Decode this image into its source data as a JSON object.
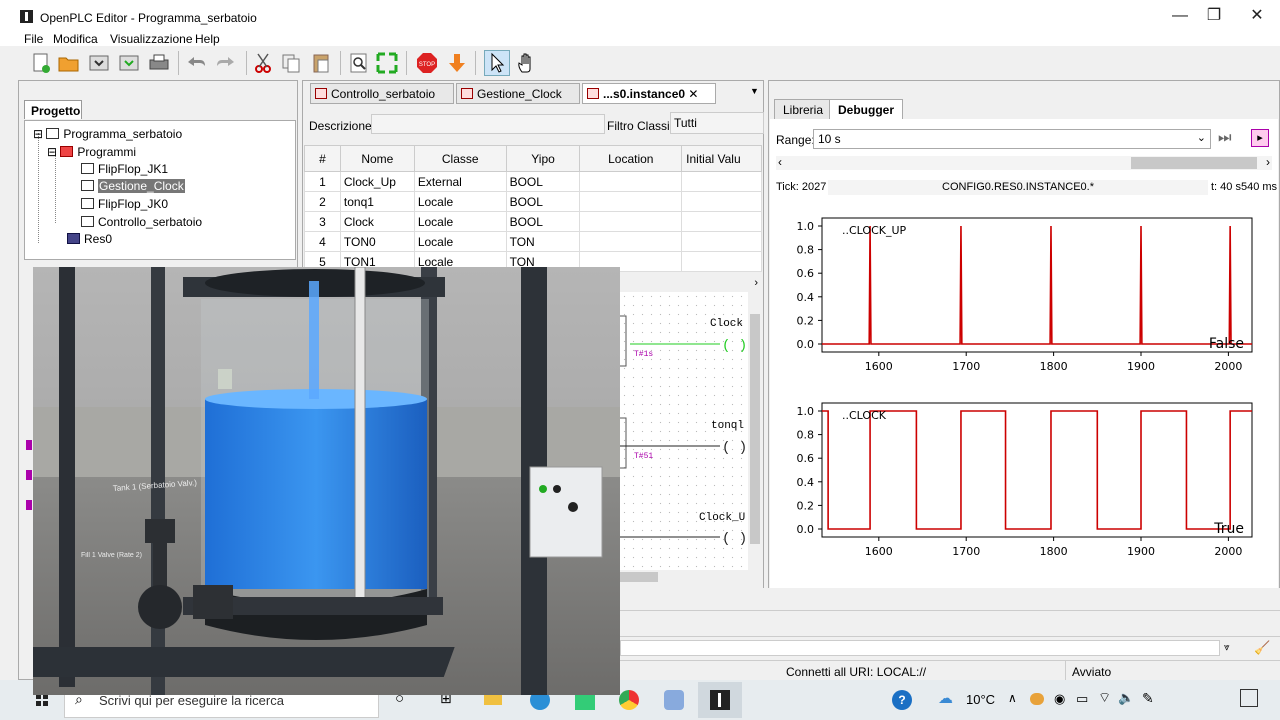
{
  "window": {
    "title": "OpenPLC Editor - Programma_serbatoio",
    "controls": {
      "minimize": "—",
      "maximize": "❐",
      "close": "✕"
    }
  },
  "menu": [
    "File",
    "Modifica",
    "Visualizzazione",
    "Help"
  ],
  "toolbar_icons": [
    "new-file-icon",
    "open-folder-icon",
    "save-icon",
    "save-as-icon",
    "print-icon",
    "undo-icon",
    "redo-icon",
    "cut-icon",
    "copy-icon",
    "paste-icon",
    "find-icon",
    "fullscreen-icon",
    "stop-icon",
    "download-icon",
    "pointer-icon",
    "hand-icon"
  ],
  "project": {
    "tab_label": "Progetto",
    "tree": {
      "root": "Programma_serbatoio",
      "programs_folder": "Programmi",
      "programs": [
        "FlipFlop_JK1",
        "Gestione_Clock",
        "FlipFlop_JK0",
        "Controllo_serbatoio"
      ],
      "selected": "Gestione_Clock",
      "resource": "Res0"
    }
  },
  "editor": {
    "tabs": [
      "Controllo_serbatoio",
      "Gestione_Clock",
      "...s0.instance0"
    ],
    "active_tab": "...s0.instance0",
    "description_label": "Descrizione:",
    "description_value": "",
    "class_filter_label": "Filtro Classi:",
    "class_filter_value": "Tutti",
    "columns": [
      "#",
      "Nome",
      "Classe",
      "Yipo",
      "Location",
      "Initial Valu"
    ],
    "rows": [
      {
        "n": "1",
        "name": "Clock_Up",
        "class": "External",
        "type": "BOOL",
        "location": "",
        "initial": ""
      },
      {
        "n": "2",
        "name": "tonq1",
        "class": "Locale",
        "type": "BOOL",
        "location": "",
        "initial": ""
      },
      {
        "n": "3",
        "name": "Clock",
        "class": "Locale",
        "type": "BOOL",
        "location": "",
        "initial": ""
      },
      {
        "n": "4",
        "name": "TON0",
        "class": "Locale",
        "type": "TON",
        "location": "",
        "initial": ""
      },
      {
        "n": "5",
        "name": "TON1",
        "class": "Locale",
        "type": "TON",
        "location": "",
        "initial": ""
      }
    ],
    "ladder": {
      "coil1": "Clock",
      "coil2": "tonql",
      "coil3": "Clock_U",
      "timer1": "T#1s",
      "timer2": "T#51"
    }
  },
  "debugger": {
    "tabs": [
      "Libreria",
      "Debugger"
    ],
    "active_tab": "Debugger",
    "range_label": "Range:",
    "range_value": "10 s",
    "tick_label": "Tick: 2027",
    "path": "CONFIG0.RES0.INSTANCE0.*",
    "time_label": "t: 40 s540 ms"
  },
  "chart_data": [
    {
      "type": "line",
      "title": "..CLOCK_UP",
      "x_ticks": [
        1600,
        1700,
        1800,
        1900,
        2000
      ],
      "y_ticks": [
        "0.0",
        "0.2",
        "0.4",
        "0.6",
        "0.8",
        "1.0"
      ],
      "xlim": [
        1535,
        2027
      ],
      "ylim": [
        0,
        1
      ],
      "pulses_at": [
        1590,
        1694,
        1797,
        1900,
        2002
      ],
      "state_label": "False",
      "color": "#cc0000"
    },
    {
      "type": "line",
      "title": "..CLOCK",
      "x_ticks": [
        1600,
        1700,
        1800,
        1900,
        2000
      ],
      "y_ticks": [
        "0.0",
        "0.2",
        "0.4",
        "0.6",
        "0.8",
        "1.0"
      ],
      "xlim": [
        1535,
        2027
      ],
      "ylim": [
        0,
        1
      ],
      "high_segments": [
        [
          1535,
          1542
        ],
        [
          1590,
          1643
        ],
        [
          1694,
          1745
        ],
        [
          1797,
          1850
        ],
        [
          1900,
          1952
        ],
        [
          2002,
          2027
        ]
      ],
      "state_label": "True",
      "color": "#cc0000"
    }
  ],
  "status": {
    "connection": "Connetti all URI: LOCAL://",
    "state": "Avviato"
  },
  "taskbar": {
    "search_placeholder": "Scrivi qui per eseguire la ricerca",
    "temperature": "10°C"
  },
  "overlay_video": {
    "label1": "Tank 1 (Serbatoio Valv.)",
    "label2": "Fill 1 Valve (Rate 2)"
  }
}
